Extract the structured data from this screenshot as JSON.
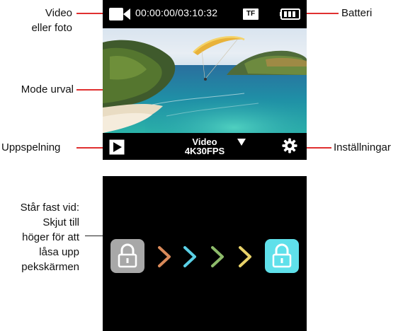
{
  "labels": {
    "video_photo_line1": "Video",
    "video_photo_line2": "eller foto",
    "battery": "Batteri",
    "mode_select": "Mode urval",
    "playback": "Uppspelning",
    "settings": "Inställningar",
    "lock_line1": "Står fast vid:",
    "lock_line2": "Skjut till",
    "lock_line3": "höger för att",
    "lock_line4": "låsa upp",
    "lock_line5": "pekskärmen"
  },
  "screen": {
    "timer": "00:00:00/03:10:32",
    "storage_badge": "TF",
    "mode_name": "Video",
    "mode_setting": "4K30FPS",
    "icons": {
      "mode": "video-camera-icon",
      "storage": "tf-card-icon",
      "battery": "battery-icon",
      "playback": "play-icon",
      "mode_dropdown": "triangle-down-icon",
      "settings": "gear-icon"
    }
  },
  "lockscreen": {
    "icons": {
      "locked": "lock-icon",
      "unlocked": "unlock-icon"
    },
    "chevron_colors": [
      "#d98a5a",
      "#5ad0e6",
      "#8dbb6a",
      "#e8d26a"
    ],
    "lock_color": "#a8a8a8",
    "unlock_color": "#5fe0ea"
  },
  "colors": {
    "pointer_line": "#e03030",
    "screen_bg": "#000000"
  }
}
